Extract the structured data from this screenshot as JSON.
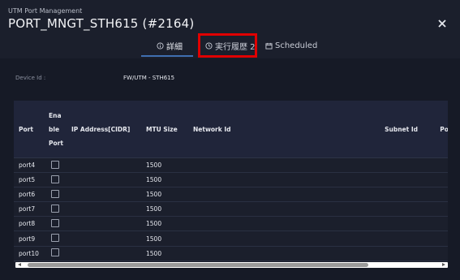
{
  "header": {
    "subtitle": "UTM Port Management",
    "title": "PORT_MNGT_STH615 (#2164)",
    "close_icon": "close-icon"
  },
  "tabs": [
    {
      "label": "詳細",
      "icon": "info-icon",
      "active": true
    },
    {
      "label": "実行履歴 2",
      "icon": "clock-icon",
      "active": false
    },
    {
      "label": "Scheduled",
      "icon": "calendar-icon",
      "active": false
    }
  ],
  "device": {
    "label": "Device Id :",
    "value": "FW/UTM - STH615"
  },
  "table": {
    "headers": {
      "port": "Port",
      "enable": "Enable Port",
      "ip": "IP Address[CIDR]",
      "mtu": "MTU Size",
      "network": "Network Id",
      "subnet": "Subnet Id",
      "port_id": "Port Id"
    },
    "rows": [
      {
        "port": "port4",
        "mtu": "1500"
      },
      {
        "port": "port5",
        "mtu": "1500"
      },
      {
        "port": "port6",
        "mtu": "1500"
      },
      {
        "port": "port7",
        "mtu": "1500"
      },
      {
        "port": "port8",
        "mtu": "1500"
      },
      {
        "port": "port9",
        "mtu": "1500"
      },
      {
        "port": "port10",
        "mtu": "1500"
      }
    ]
  },
  "colors": {
    "background": "#1b1f2c",
    "accent": "#3f6fb0",
    "highlight": "#e00000"
  }
}
